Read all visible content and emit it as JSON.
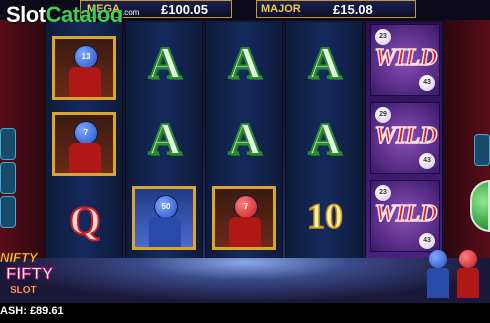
{
  "watermark": {
    "slot": "Slot",
    "catalog": "Catalog",
    "suffix": ".com"
  },
  "jackpots": [
    {
      "label": "MEGA",
      "value": "£100.05"
    },
    {
      "label": "MAJOR",
      "value": "£15.08"
    }
  ],
  "reels": {
    "col1": [
      {
        "type": "character",
        "ball_number": "13"
      },
      {
        "type": "character",
        "ball_number": "7"
      },
      {
        "type": "symbol",
        "glyph": "Q"
      }
    ],
    "col2": [
      {
        "type": "symbol",
        "glyph": "A"
      },
      {
        "type": "symbol",
        "glyph": "A"
      },
      {
        "type": "character",
        "ball_number": "50"
      }
    ],
    "col3": [
      {
        "type": "symbol",
        "glyph": "A"
      },
      {
        "type": "symbol",
        "glyph": "A"
      },
      {
        "type": "character",
        "ball_number": "7"
      }
    ],
    "col4": [
      {
        "type": "symbol",
        "glyph": "A"
      },
      {
        "type": "symbol",
        "glyph": "A"
      },
      {
        "type": "symbol",
        "glyph": "10"
      }
    ],
    "col5": [
      {
        "type": "wild",
        "label": "WILD"
      },
      {
        "type": "wild",
        "label": "WILD"
      },
      {
        "type": "wild",
        "label": "WILD"
      }
    ]
  },
  "game_logo": {
    "line1": "NIFTY",
    "line2": "FIFTY",
    "line3": "SLOT"
  },
  "footer": {
    "cash": "ASH: £89.61"
  },
  "colors": {
    "accent_gold": "#d8a530",
    "wild_red": "#e01c28",
    "a_green": "#2b8b32",
    "spin_green": "#1c8a2a"
  }
}
